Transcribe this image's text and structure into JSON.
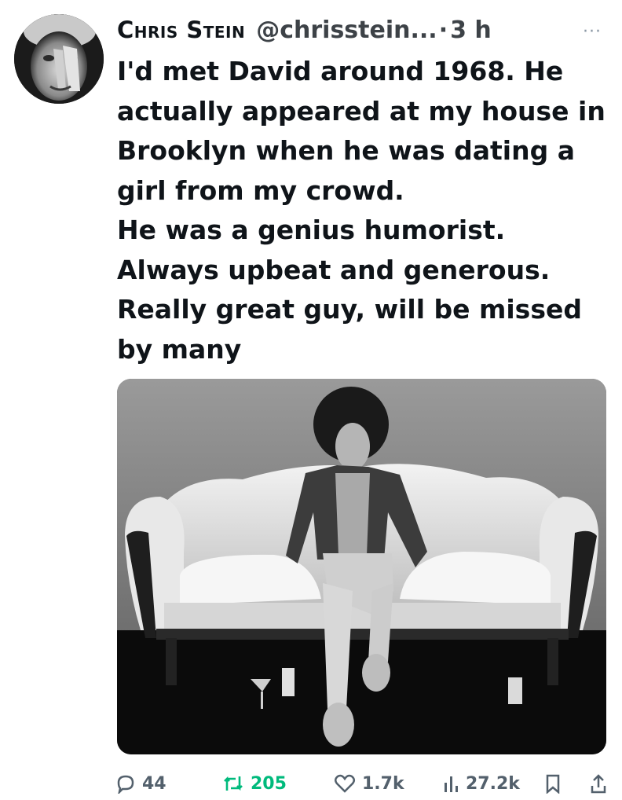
{
  "author": {
    "name": "Chris Stein",
    "handle": "@chrisstein...",
    "separator": "·",
    "time": "3 h"
  },
  "more_label": "···",
  "tweet_lines": [
    "I'd met David around 1968. He",
    "actually appeared at my house in",
    "Brooklyn when he was dating a",
    "girl from my crowd.",
    "He was a genius humorist.",
    "Always upbeat and generous.",
    "Really great guy, will be missed",
    "by many"
  ],
  "actions": {
    "replies": "44",
    "retweets": "205",
    "likes": "1.7k",
    "views": "27.2k"
  },
  "colors": {
    "retweet": "#00ba7c",
    "icon": "#53606c"
  },
  "icons": {
    "more": "more-dots-icon",
    "reply": "reply-bubble-icon",
    "retweet": "retweet-icon",
    "like": "heart-icon",
    "views": "views-bar-icon",
    "bookmark": "bookmark-icon",
    "share": "share-icon"
  }
}
